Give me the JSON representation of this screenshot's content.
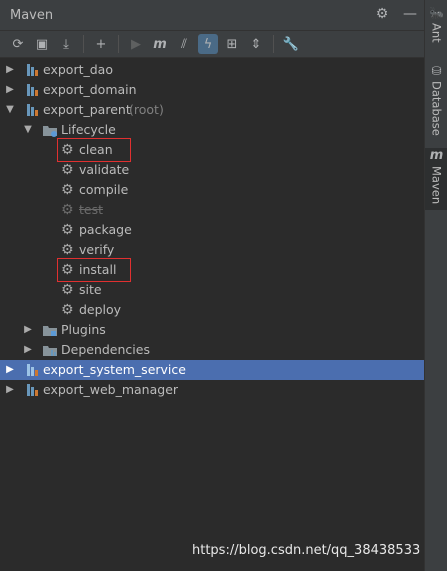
{
  "window": {
    "title": "Maven"
  },
  "toolbar": {
    "buttons": [
      {
        "name": "refresh-icon",
        "glyph": "⟳"
      },
      {
        "name": "add-project-icon",
        "glyph": "▣"
      },
      {
        "name": "download-icon",
        "glyph": "⤓"
      },
      {
        "name": "plus-icon",
        "glyph": "+"
      },
      {
        "name": "run-icon",
        "glyph": "▶"
      },
      {
        "name": "maven-goal-icon",
        "glyph": "m"
      },
      {
        "name": "toggle-offline-icon",
        "glyph": "⫽"
      },
      {
        "name": "skip-tests-icon",
        "glyph": "ϟ"
      },
      {
        "name": "show-dependencies-icon",
        "glyph": "⊞"
      },
      {
        "name": "collapse-all-icon",
        "glyph": "⇕"
      },
      {
        "name": "settings-wrench-icon",
        "glyph": "🔧"
      }
    ]
  },
  "tree": {
    "projects": [
      {
        "label": "export_dao",
        "expanded": false
      },
      {
        "label": "export_domain",
        "expanded": false
      },
      {
        "label": "export_parent",
        "suffix": "(root)",
        "expanded": true
      }
    ],
    "lifecycle": {
      "label": "Lifecycle",
      "phases": [
        "clean",
        "validate",
        "compile",
        "test",
        "package",
        "verify",
        "install",
        "site",
        "deploy"
      ],
      "disabled_phase": "test",
      "highlighted": [
        "clean",
        "install"
      ]
    },
    "plugins_label": "Plugins",
    "dependencies_label": "Dependencies",
    "more_projects": [
      {
        "label": "export_system_service",
        "selected": true
      },
      {
        "label": "export_web_manager",
        "selected": false
      }
    ]
  },
  "sidebar": {
    "tabs": [
      {
        "label": "Ant",
        "icon": "ant-icon",
        "glyph": "🐜"
      },
      {
        "label": "Database",
        "icon": "database-icon",
        "glyph": "⛁"
      },
      {
        "label": "Maven",
        "icon": "maven-icon",
        "glyph": "m",
        "active": true
      }
    ]
  },
  "watermark": "https://blog.csdn.net/qq_38438533",
  "colors": {
    "selection": "#4b6eaf",
    "highlight_box": "#e03030",
    "background": "#2b2b2b"
  }
}
